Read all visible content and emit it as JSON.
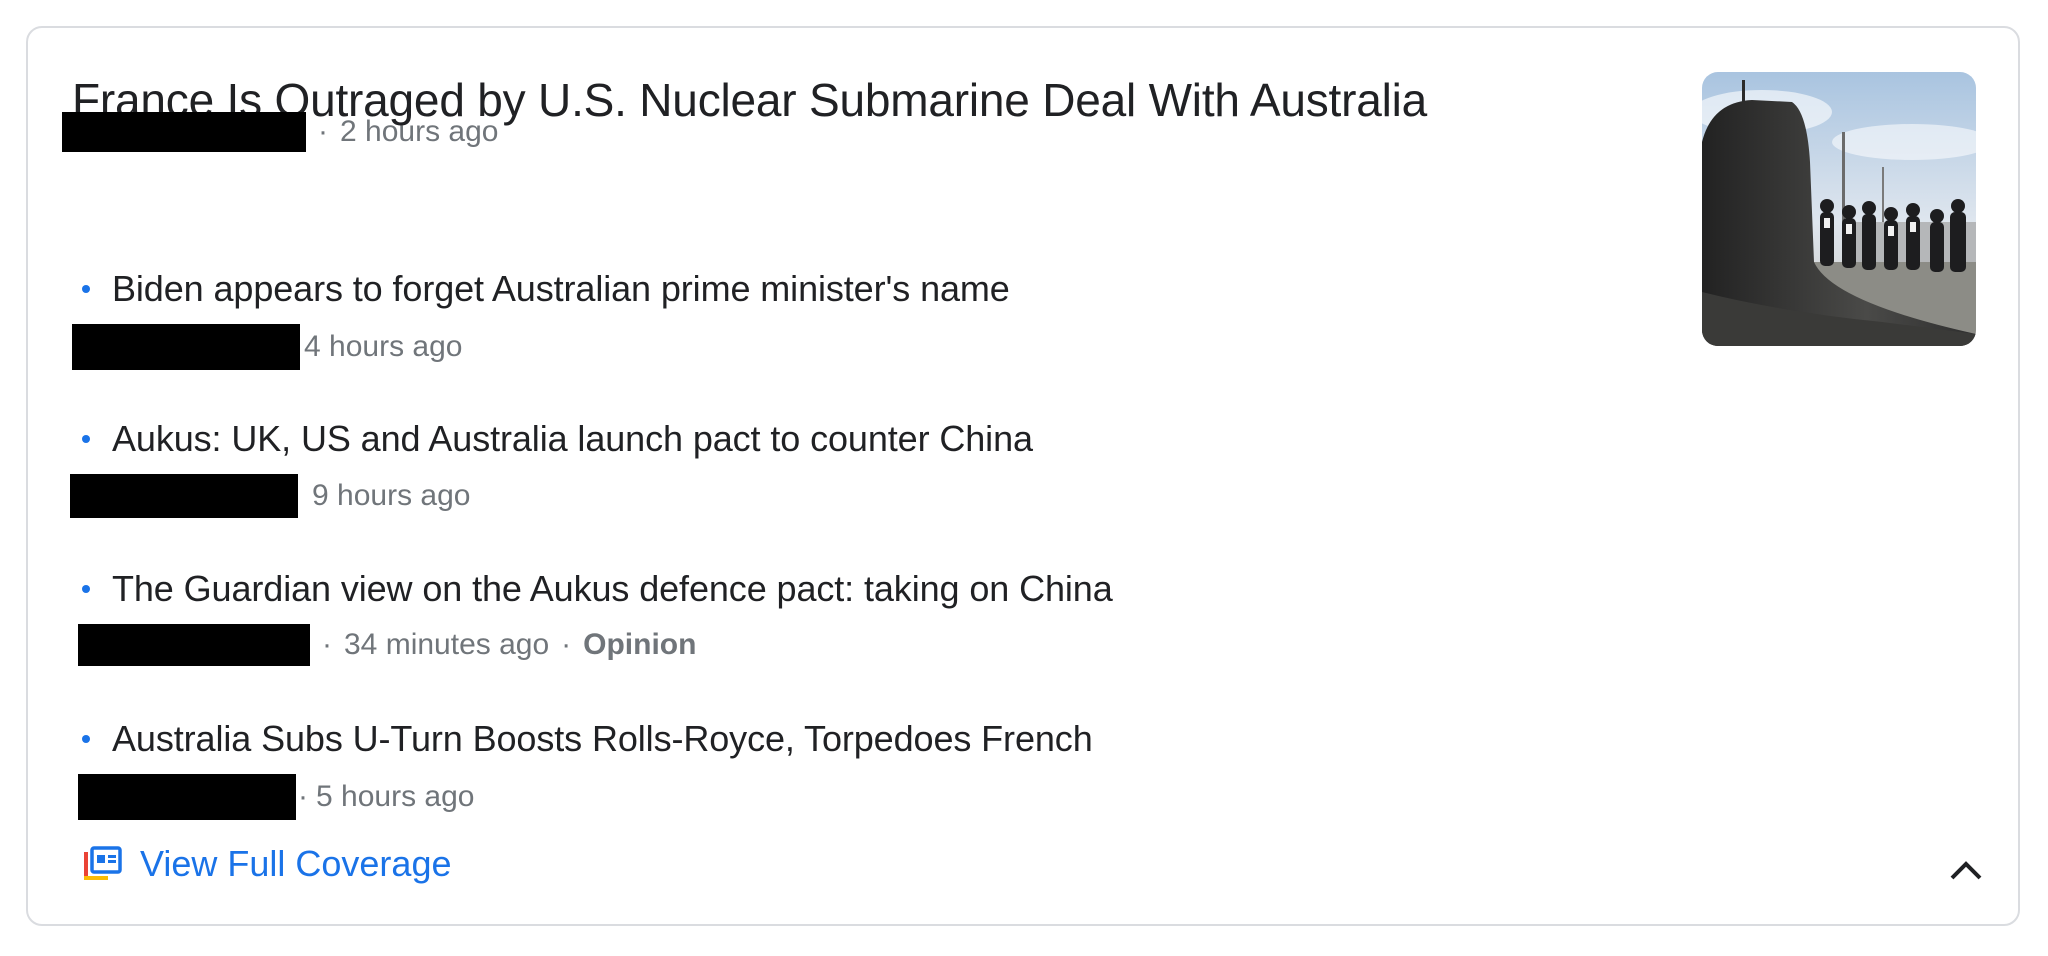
{
  "card": {
    "headline": "France Is Outraged by U.S. Nuclear Submarine Deal With Australia",
    "headline_time": "2 hours ago",
    "separator": "·",
    "thumbnail_icon": "submarine-photo-icon"
  },
  "stories": [
    {
      "title": "Biden appears to forget Australian prime minister's name",
      "time": "4 hours ago"
    },
    {
      "title": "Aukus: UK, US and Australia launch pact to counter China",
      "time": "9 hours ago"
    },
    {
      "title": "The Guardian view on the Aukus defence pact: taking on China",
      "time": "34 minutes ago",
      "label": "Opinion"
    },
    {
      "title": "Australia Subs U-Turn Boosts Rolls-Royce, Torpedoes French",
      "time": "5 hours ago"
    }
  ],
  "footer": {
    "coverage_label": "View Full Coverage",
    "coverage_icon": "full-coverage-icon",
    "collapse_icon": "chevron-up-icon"
  },
  "colors": {
    "accent": "#1a73e8",
    "headline": "#202124",
    "meta": "#70757a",
    "border": "#dadce0"
  }
}
